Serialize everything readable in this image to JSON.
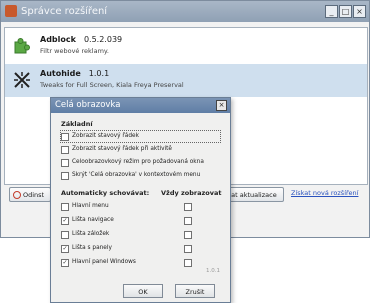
{
  "window": {
    "title": "Správce rozšíření",
    "buttons": {
      "minimize": "_",
      "maximize": "□",
      "close": "×"
    }
  },
  "extensions": [
    {
      "name": "Adblock",
      "version": "0.5.2.039",
      "description": "Filtr webové reklamy.",
      "icon": "puzzle-icon",
      "selected": false
    },
    {
      "name": "Autohide",
      "version": "1.0.1",
      "description": "Tweaks for Full Screen, Kiala Freya Preserval",
      "icon": "autohide-icon",
      "selected": true
    }
  ],
  "bottom": {
    "disable_label": "Odinst",
    "update_label": "dat aktualizace",
    "get_link": "Získat nová rozšíření"
  },
  "dialog": {
    "title": "Celá obrazovka",
    "close": "×",
    "section_basic": "Základní",
    "basic_options": [
      {
        "label": "Zobrazit stavový řádek",
        "checked": false
      },
      {
        "label": "Zobrazit stavový řádek při aktivitě",
        "checked": false
      },
      {
        "label": "Celoobrazovkový režim pro požadovaná okna",
        "checked": false
      },
      {
        "label": "Skrýt 'Celá obrazovka' v kontextovém menu",
        "checked": false
      }
    ],
    "section_auto_hide": "Automaticky schovávat:",
    "section_always_show": "Vždy zobrazovat",
    "hide_options": [
      {
        "label": "Hlavní menu",
        "checked": false,
        "always": false
      },
      {
        "label": "Lišta navigace",
        "checked": true,
        "always": false
      },
      {
        "label": "Lišta záložek",
        "checked": false,
        "always": false
      },
      {
        "label": "Lišta s panely",
        "checked": true,
        "always": false
      },
      {
        "label": "Hlavní panel Windows",
        "checked": true,
        "always": false
      }
    ],
    "version": "1.0.1",
    "ok": "OK",
    "cancel": "Zrušit"
  }
}
